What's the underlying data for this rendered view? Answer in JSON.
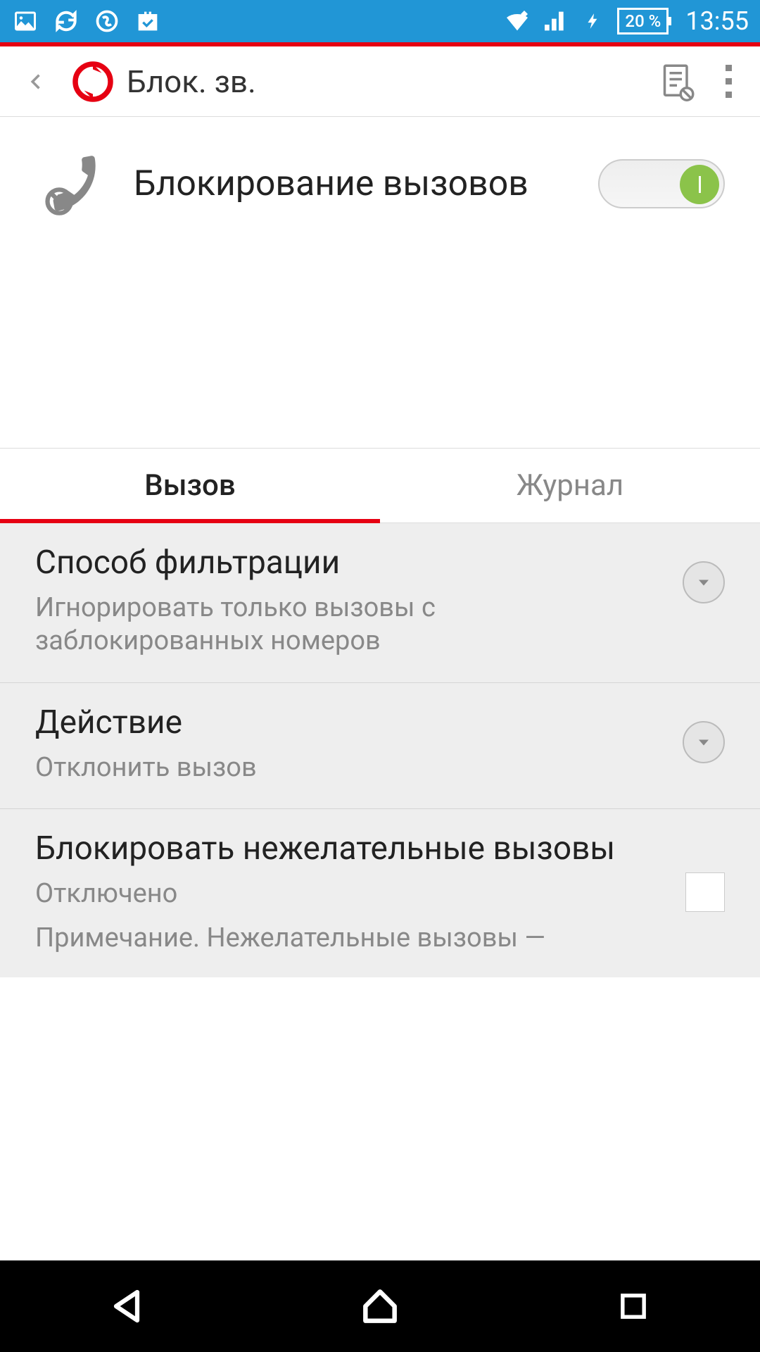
{
  "status": {
    "battery_pct": "20 %",
    "clock": "13:55"
  },
  "appbar": {
    "title": "Блок. зв."
  },
  "feature": {
    "label": "Блокирование вызовов",
    "enabled": true
  },
  "tabs": [
    {
      "label": "Вызов",
      "active": true
    },
    {
      "label": "Журнал",
      "active": false
    }
  ],
  "settings": {
    "filter": {
      "title": "Способ фильтрации",
      "value": "Игнорировать только вызовы с заблокированных номеров"
    },
    "action": {
      "title": "Действие",
      "value": "Отклонить вызов"
    },
    "block_unwanted": {
      "title": "Блокировать нежелательные вызовы",
      "value": "Отключено",
      "note": "Примечание. Нежелательные вызовы —",
      "checked": false
    }
  }
}
